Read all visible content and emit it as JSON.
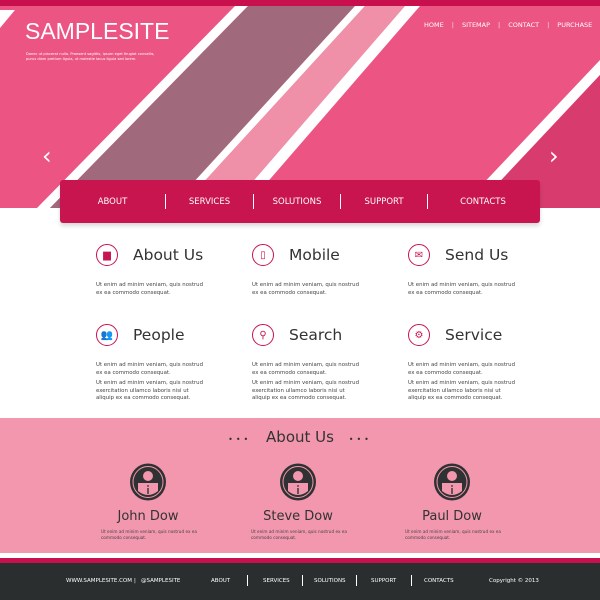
{
  "header": {
    "logo": "SAMPLESITE",
    "tagline": "Donec ut placerat nulla. Praesent sagittis, ipsum eget feugiat convallis, purus diam pretium ligula, ut molestie lacus ligula sed lorem.",
    "top_nav": [
      "HOME",
      "SITEMAP",
      "CONTACT",
      "PURCHASE"
    ],
    "prev_arrow": "‹",
    "next_arrow": "›"
  },
  "main_nav": [
    "ABOUT",
    "SERVICES",
    "SOLUTIONS",
    "SUPPORT",
    "CONTACTS"
  ],
  "features": [
    {
      "title": "About Us",
      "icon": "book-icon",
      "glyph": "▆",
      "texts": [
        "Ut enim ad minim veniam, quis nostrud ex ea commodo consequat."
      ]
    },
    {
      "title": "Mobile",
      "icon": "mobile-icon",
      "glyph": "▯",
      "texts": [
        "Ut enim ad minim veniam, quis nostrud ex ea commodo consequat."
      ]
    },
    {
      "title": "Send Us",
      "icon": "envelope-icon",
      "glyph": "✉",
      "texts": [
        "Ut enim ad minim veniam, quis nostrud ex ea commodo consequat."
      ]
    },
    {
      "title": "People",
      "icon": "people-icon",
      "glyph": "👥",
      "texts": [
        "Ut enim ad minim veniam, quis nostrud ex ea commodo consequat.",
        "Ut enim ad minim veniam, quis nostrud exercitation ullamco laboris nisi ut aliquip ex ea commodo consequat."
      ]
    },
    {
      "title": "Search",
      "icon": "search-icon",
      "glyph": "⚲",
      "texts": [
        "Ut enim ad minim veniam, quis nostrud ex ea commodo consequat.",
        "Ut enim ad minim veniam, quis nostrud exercitation ullamco laboris nisi ut aliquip ex ea commodo consequat."
      ]
    },
    {
      "title": "Service",
      "icon": "gear-icon",
      "glyph": "⚙",
      "texts": [
        "Ut enim ad minim veniam, quis nostrud ex ea commodo consequat.",
        "Ut enim ad minim veniam, quis nostrud exercitation ullamco laboris nisi ut aliquip ex ea commodo consequat."
      ]
    }
  ],
  "team": {
    "title": "About Us",
    "dots": "•••",
    "members": [
      {
        "name": "John Dow",
        "text": "Ut enim ad minim veniam, quis nostrud ex ea commodo consequat."
      },
      {
        "name": "Steve Dow",
        "text": "Ut enim ad minim veniam, quis nostrud ex ea commodo consequat."
      },
      {
        "name": "Paul Dow",
        "text": "Ut enim ad minim veniam, quis nostrud ex ea commodo consequat."
      }
    ]
  },
  "footer": {
    "website": "WWW.SAMPLESITE.COM",
    "separator": "|",
    "handle": "@SAMPLESITE",
    "links": [
      "ABOUT",
      "SERVICES",
      "SOLUTIONS",
      "SUPPORT",
      "CONTACTS"
    ],
    "copyright": "Copyright © 2013"
  },
  "colors": {
    "accent": "#c8144f",
    "hero": "#ec5484",
    "team_bg": "#f297ad",
    "footer_bg": "#2a2e2f"
  }
}
